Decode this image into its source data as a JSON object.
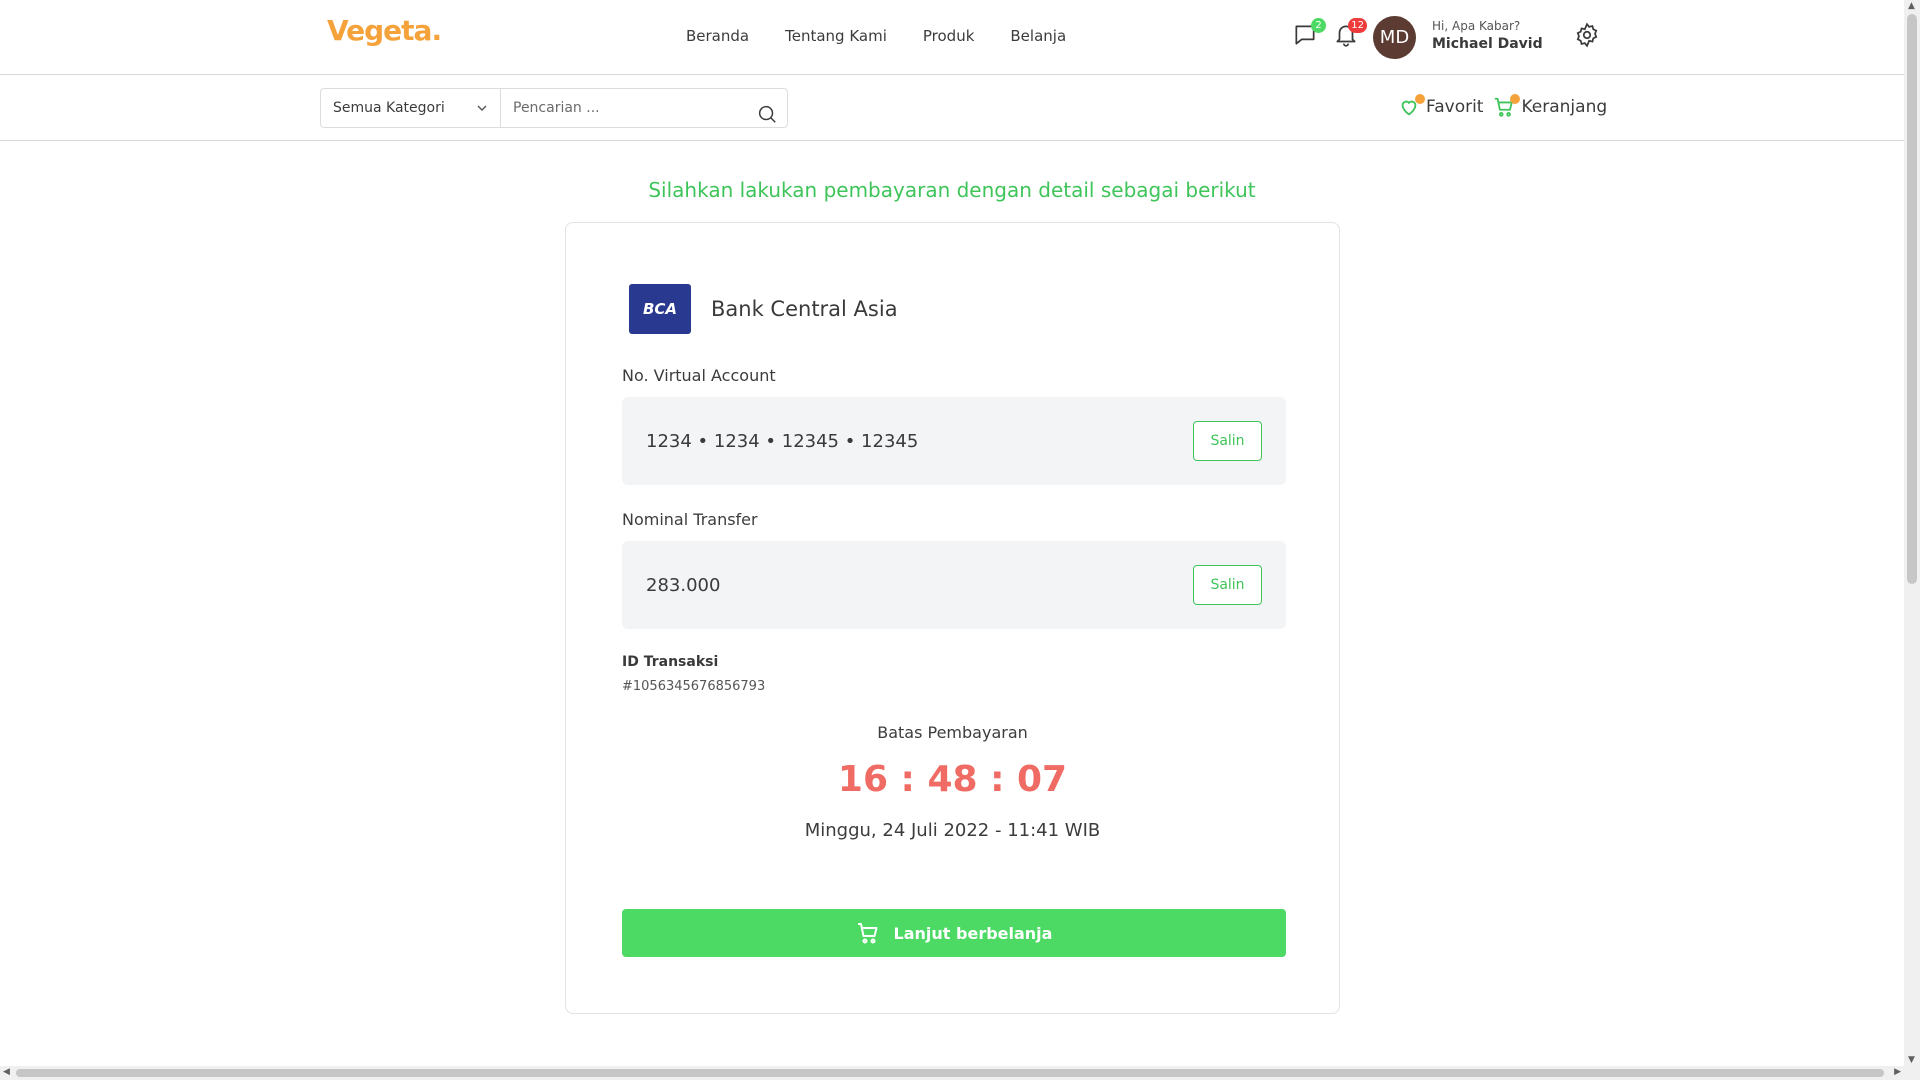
{
  "header": {
    "logo": "Vegeta.",
    "nav": [
      "Beranda",
      "Tentang Kami",
      "Produk",
      "Belanja"
    ],
    "messages_count": "2",
    "notifications_count": "12",
    "avatar_initials": "MD",
    "greeting": "Hi, Apa Kabar?",
    "user_name": "Michael David"
  },
  "search": {
    "category": "Semua Kategori",
    "placeholder": "Pencarian ..."
  },
  "quick_links": {
    "favorites": "Favorit",
    "cart": "Keranjang"
  },
  "payment": {
    "heading": "Silahkan lakukan pembayaran dengan detail sebagai berikut",
    "bank_logo_text": "BCA",
    "bank_name": "Bank Central Asia",
    "va_label": "No. Virtual Account",
    "va_number": "1234 • 1234 • 12345 • 12345",
    "amount_label": "Nominal Transfer",
    "amount": "283.000",
    "copy_label": "Salin",
    "txid_label": "ID Transaksi",
    "txid": "#1056345676856793",
    "deadline_label": "Batas Pembayaran",
    "countdown": "16 : 48 : 07",
    "deadline_date": "Minggu, 24 Juli 2022 - 11:41 WIB",
    "continue_label": "Lanjut berbelanja"
  },
  "colors": {
    "brand_orange": "#f5a23a",
    "accent_green": "#4cd964",
    "timer_red": "#ef6b64"
  }
}
